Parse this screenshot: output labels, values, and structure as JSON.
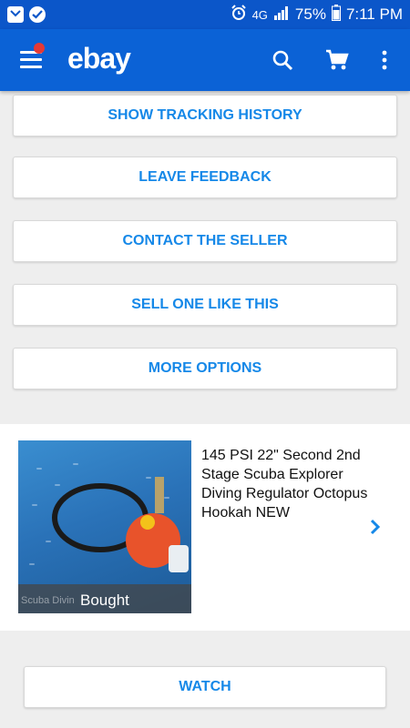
{
  "status_bar": {
    "battery": "75%",
    "time": "7:11 PM",
    "network": "4G"
  },
  "app_bar": {
    "logo": "ebay",
    "icons": [
      "menu-icon",
      "search-icon",
      "cart-icon",
      "more-vert-icon"
    ],
    "notification_color": "#e53935"
  },
  "actions": {
    "tracking": "SHOW TRACKING HISTORY",
    "feedback": "LEAVE FEEDBACK",
    "contact": "CONTACT THE SELLER",
    "sell": "SELL ONE LIKE THIS",
    "more": "MORE OPTIONS"
  },
  "item": {
    "title": "145 PSI 22\" Second 2nd Stage Scuba Explorer Diving Regulator Octopus Hookah NEW",
    "badge": "Bought",
    "watermark": "Scuba Divin"
  },
  "watch": {
    "label": "WATCH"
  },
  "colors": {
    "brand": "#0b62d6",
    "accent": "#1588e8"
  }
}
